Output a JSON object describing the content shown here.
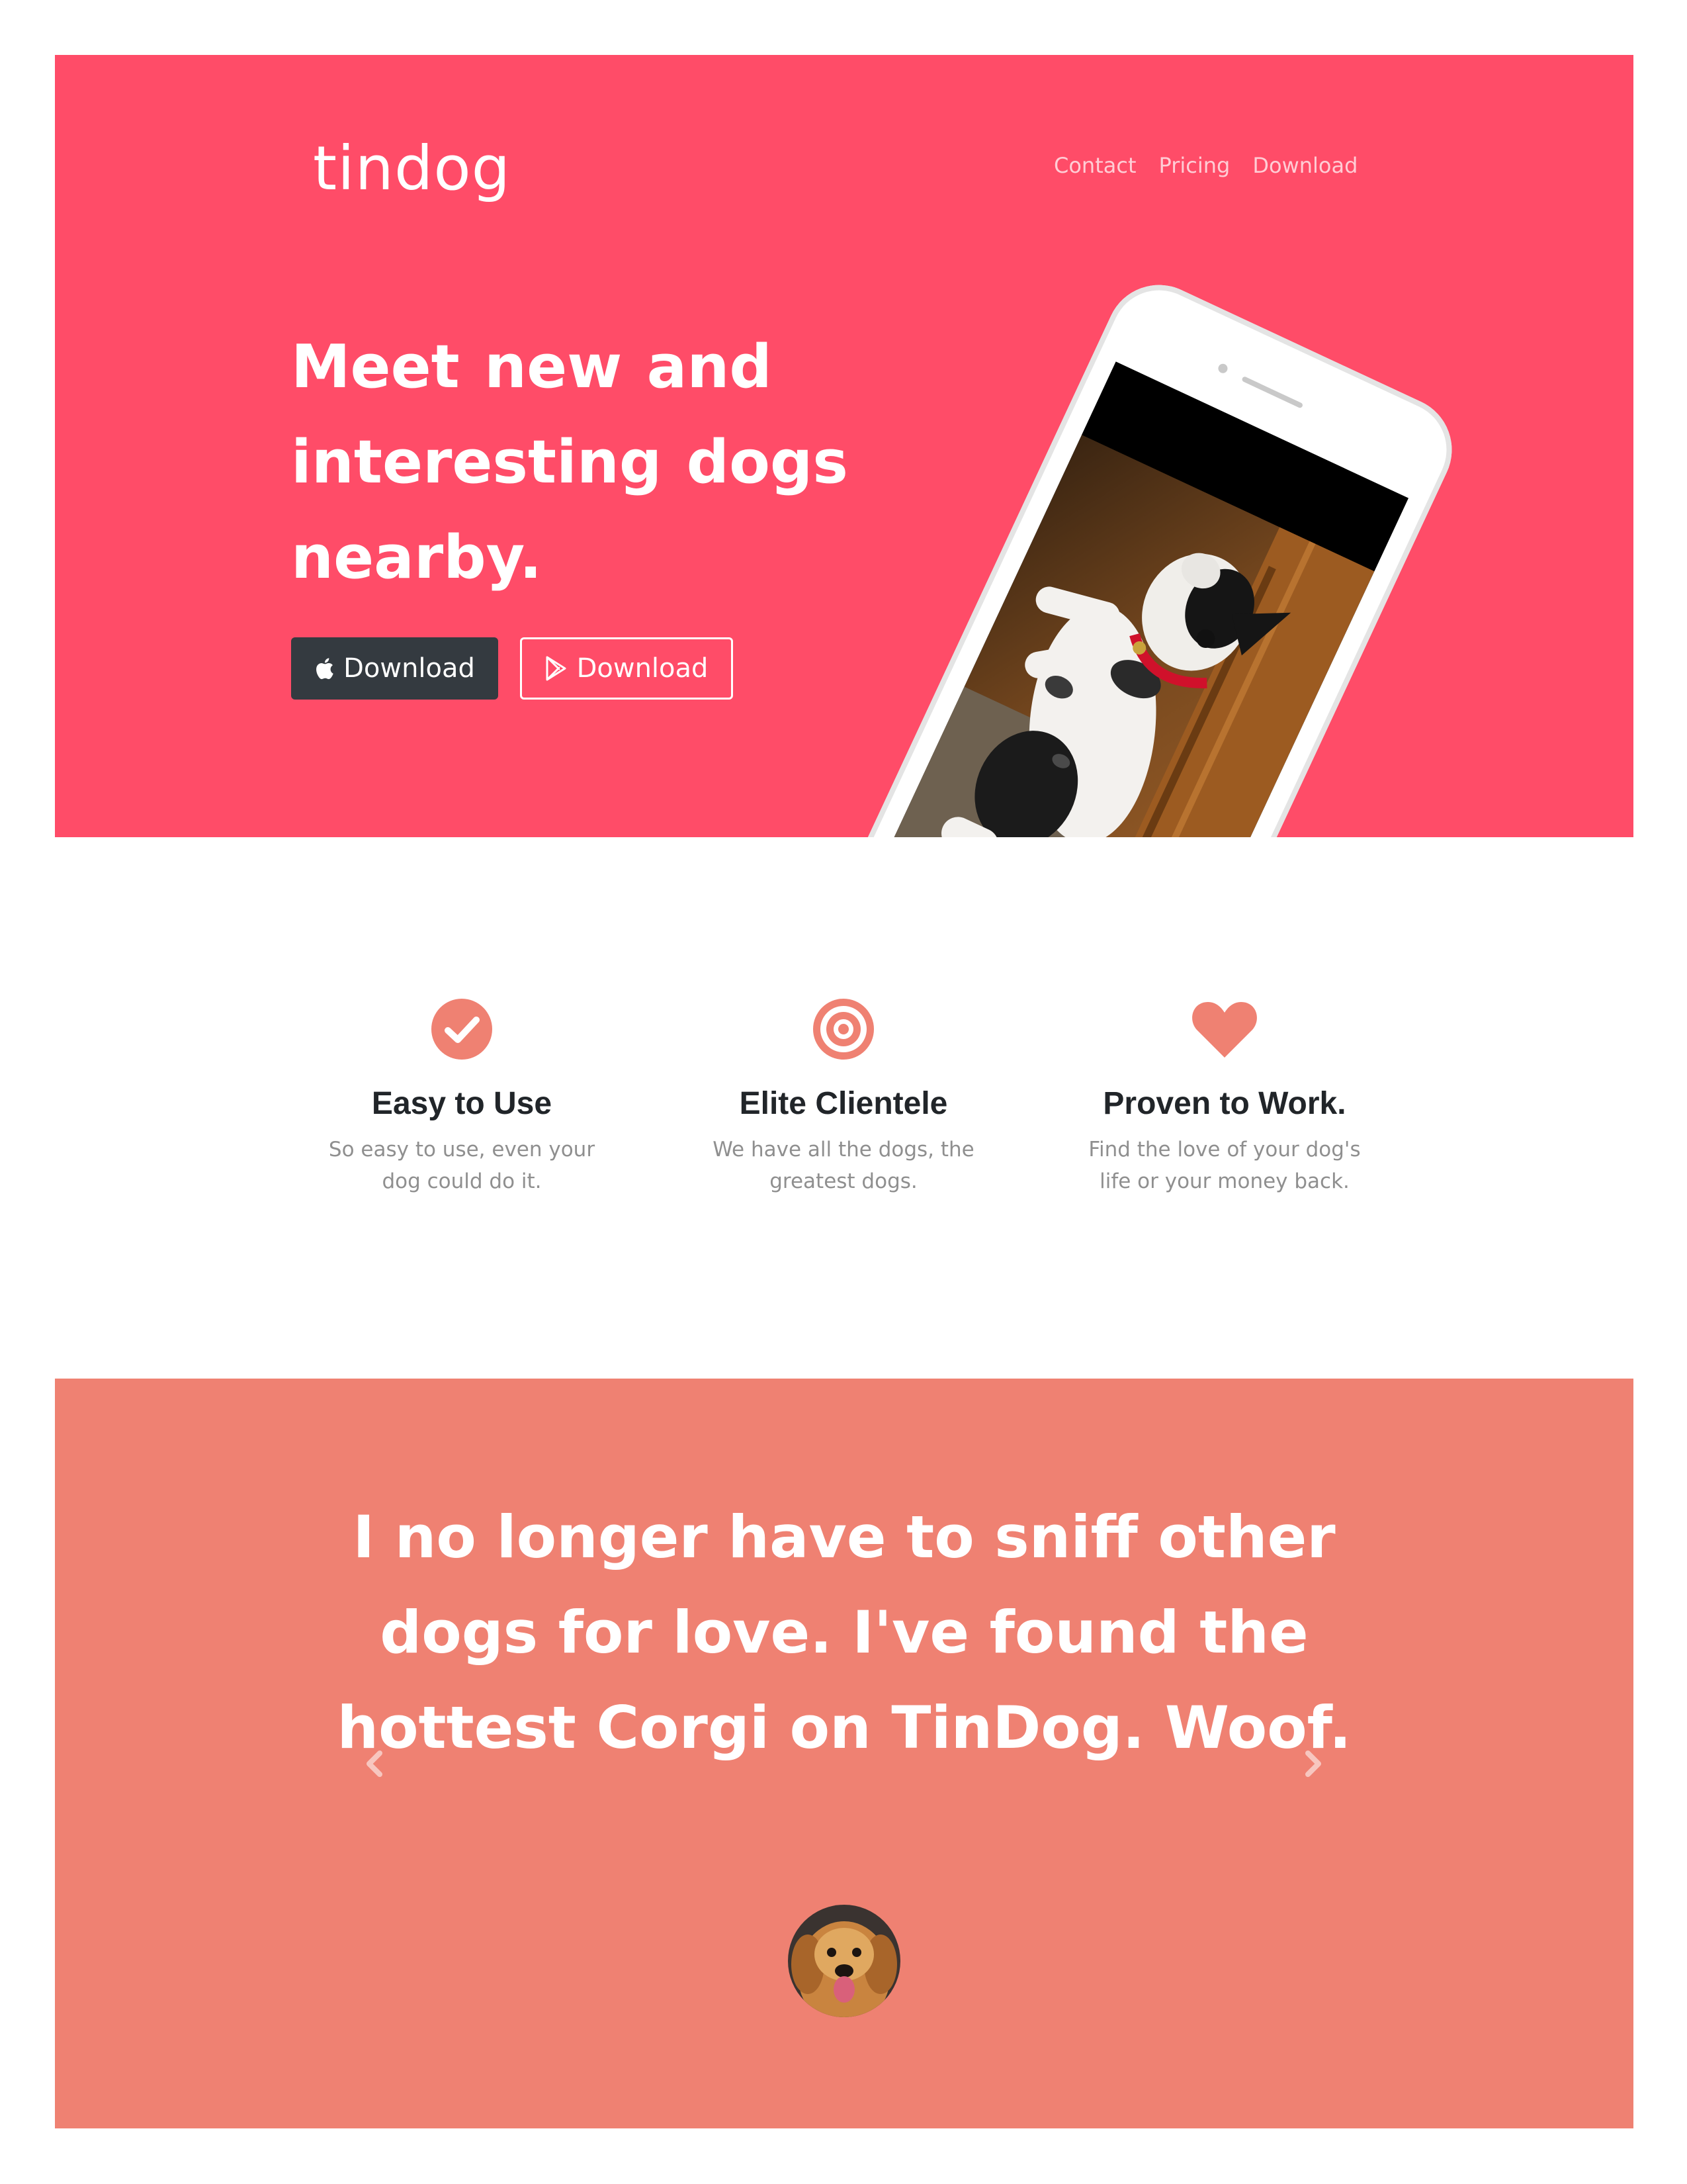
{
  "header": {
    "brand": "tindog",
    "nav": [
      {
        "label": "Contact"
      },
      {
        "label": "Pricing"
      },
      {
        "label": "Download"
      }
    ]
  },
  "hero": {
    "headline": "Meet new and interesting dogs nearby.",
    "buttons": [
      {
        "label": "Download",
        "icon": "apple-icon"
      },
      {
        "label": "Download",
        "icon": "play-store-icon"
      }
    ],
    "phone_screen_image": "dog-photo"
  },
  "features": [
    {
      "icon": "check-circle-icon",
      "title": "Easy to Use",
      "text": "So easy to use, even your dog could do it."
    },
    {
      "icon": "bullseye-icon",
      "title": "Elite Clientele",
      "text": "We have all the dogs, the greatest dogs."
    },
    {
      "icon": "heart-icon",
      "title": "Proven to Work.",
      "text": "Find the love of your dog's life or your money back."
    }
  ],
  "testimonial": {
    "quote": "I no longer have to sniff other dogs for love. I've found the hottest Corgi on TinDog. Woof.",
    "avatar": "dog-avatar",
    "prev_icon": "chevron-left-icon",
    "next_icon": "chevron-right-icon"
  },
  "colors": {
    "hero_bg": "#ff4c68",
    "testimonial_bg": "#ef8172",
    "icon_accent": "#ef8172",
    "dark_button": "#343a40"
  }
}
